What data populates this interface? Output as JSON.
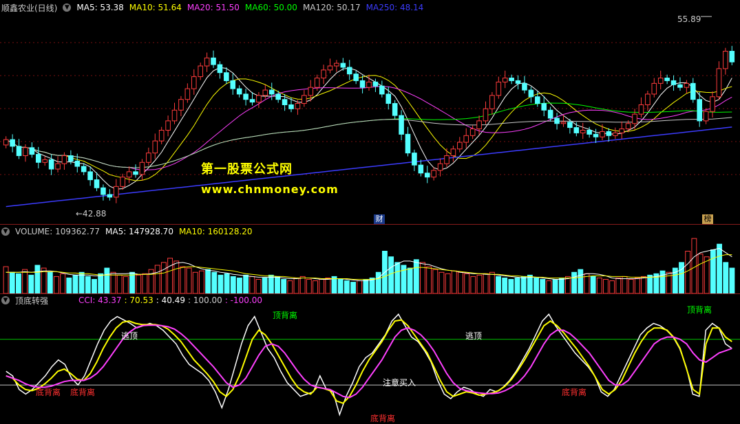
{
  "colors": {
    "up": "#ff3c3c",
    "down": "#54ffff",
    "ma5": "#ffffff",
    "ma10": "#ffff00",
    "ma20": "#ff40ff",
    "ma60": "#00ff00",
    "ma120": "#cccccc",
    "ma250": "#3c3cff",
    "grid": "#7a1010",
    "cci_white": "#ffffff",
    "cci_yellow": "#ffff00",
    "cci_magenta": "#ff40ff",
    "level_green": "#00c000",
    "level_white": "#c0c0c0"
  },
  "price_panel": {
    "title": "顺鑫农业(日线)",
    "collapse_icon": "chevron-down-icon",
    "ma_labels": [
      {
        "text": "MA5: 53.38",
        "color": "#ffffff"
      },
      {
        "text": "MA10: 51.64",
        "color": "#ffff00"
      },
      {
        "text": "MA20: 51.50",
        "color": "#ff40ff"
      },
      {
        "text": "MA60: 50.00",
        "color": "#00ff00"
      },
      {
        "text": "MA120: 50.17",
        "color": "#cccccc"
      },
      {
        "text": "MA250: 48.14",
        "color": "#3c3cff"
      }
    ],
    "high_label": "55.89",
    "low_label": "42.88",
    "event_tags": [
      "财",
      "榜"
    ]
  },
  "watermark": {
    "line1": "第一股票公式网",
    "line2": "www.chnmoney.com"
  },
  "volume_panel": {
    "labels": [
      {
        "text": "VOLUME: 109362.77",
        "color": "#cccccc"
      },
      {
        "text": "MA5: 147928.70",
        "color": "#ffffff"
      },
      {
        "text": "MA10: 160128.20",
        "color": "#ffff00"
      }
    ]
  },
  "indicator_panel": {
    "title": "顶底转强",
    "labels": [
      {
        "text": "CCI: 43.37",
        "color": "#ff40ff"
      },
      {
        "text": ": 70.53",
        "color": "#ffff00"
      },
      {
        "text": ": 40.49",
        "color": "#ffffff"
      },
      {
        "text": ": 100.00",
        "color": "#cccccc"
      },
      {
        "text": ": -100.00",
        "color": "#ff40ff"
      }
    ],
    "annotations": [
      {
        "text": "底背离",
        "color": "#ff3030"
      },
      {
        "text": "底背离",
        "color": "#ff3030"
      },
      {
        "text": "逃顶",
        "color": "#ffffff"
      },
      {
        "text": "逃顶",
        "color": "#ffffff"
      },
      {
        "text": "底背离",
        "color": "#ff3030"
      },
      {
        "text": "底背离",
        "color": "#ff3030"
      },
      {
        "text": "顶背离",
        "color": "#00ff00"
      },
      {
        "text": "注意买入",
        "color": "#ffffff"
      },
      {
        "text": "顶背离",
        "color": "#00ff00"
      }
    ]
  },
  "chart_data": [
    {
      "type": "candlestick",
      "title": "顺鑫农业(日线)",
      "high_marker": 55.89,
      "low_marker": 42.88,
      "ylim": [
        41.5,
        57.0
      ],
      "closes": [
        47.6,
        47.1,
        46.4,
        47.0,
        46.5,
        45.9,
        46.1,
        45.4,
        45.8,
        46.4,
        46.0,
        45.6,
        45.2,
        44.6,
        44.0,
        43.5,
        43.3,
        44.1,
        44.8,
        45.2,
        45.0,
        45.9,
        46.6,
        47.5,
        48.3,
        49.0,
        49.8,
        50.6,
        51.4,
        52.3,
        53.1,
        53.7,
        53.2,
        52.6,
        52.0,
        51.4,
        51.0,
        50.6,
        50.4,
        50.9,
        51.3,
        51.0,
        50.6,
        50.2,
        49.9,
        50.3,
        50.9,
        51.5,
        52.2,
        52.8,
        53.1,
        53.3,
        53.0,
        52.5,
        52.0,
        51.5,
        51.9,
        51.6,
        51.0,
        50.3,
        49.4,
        48.0,
        46.6,
        45.7,
        45.1,
        44.8,
        45.3,
        45.8,
        46.4,
        46.9,
        47.4,
        47.9,
        48.4,
        49.0,
        49.9,
        50.9,
        51.9,
        52.2,
        52.0,
        51.8,
        51.3,
        50.8,
        50.3,
        49.8,
        49.2,
        48.8,
        48.9,
        48.5,
        48.1,
        48.3,
        48.0,
        47.8,
        48.2,
        47.9,
        48.1,
        48.4,
        48.8,
        49.5,
        50.2,
        51.0,
        51.8,
        52.2,
        52.0,
        51.7,
        51.5,
        51.8,
        50.6,
        49.0,
        49.7,
        50.8,
        52.9,
        54.2,
        53.4
      ],
      "opens": [
        47.2,
        47.6,
        47.1,
        46.4,
        47.0,
        46.5,
        45.9,
        46.1,
        45.4,
        45.8,
        46.4,
        46.0,
        45.6,
        45.2,
        44.6,
        44.0,
        43.5,
        43.3,
        44.1,
        44.8,
        45.2,
        45.0,
        45.9,
        46.6,
        47.5,
        48.3,
        49.0,
        49.8,
        50.6,
        51.4,
        52.3,
        53.1,
        53.7,
        53.2,
        52.6,
        52.0,
        51.4,
        51.0,
        50.6,
        50.4,
        50.9,
        51.3,
        51.0,
        50.6,
        50.2,
        49.9,
        50.3,
        50.9,
        51.5,
        52.2,
        52.8,
        53.1,
        53.3,
        53.0,
        52.5,
        52.0,
        51.5,
        51.9,
        51.6,
        51.0,
        50.3,
        49.4,
        48.0,
        46.6,
        45.7,
        45.1,
        44.8,
        45.3,
        45.8,
        46.4,
        46.9,
        47.4,
        47.9,
        48.4,
        49.0,
        49.9,
        50.9,
        51.9,
        52.2,
        52.0,
        51.8,
        51.3,
        50.8,
        50.3,
        49.8,
        49.2,
        48.8,
        48.9,
        48.5,
        48.1,
        48.3,
        48.0,
        47.8,
        48.2,
        47.9,
        48.1,
        48.4,
        48.8,
        49.5,
        50.2,
        51.0,
        51.8,
        52.2,
        52.0,
        51.7,
        51.5,
        51.8,
        50.6,
        49.0,
        49.7,
        50.8,
        52.9,
        54.2
      ]
    },
    {
      "type": "bar",
      "title": "VOLUME",
      "values": [
        38,
        30,
        28,
        34,
        26,
        40,
        36,
        30,
        24,
        28,
        22,
        26,
        30,
        24,
        20,
        28,
        36,
        30,
        26,
        24,
        30,
        26,
        28,
        34,
        40,
        44,
        50,
        46,
        38,
        36,
        30,
        32,
        34,
        30,
        26,
        28,
        24,
        22,
        26,
        24,
        20,
        22,
        26,
        24,
        20,
        18,
        22,
        24,
        20,
        18,
        20,
        22,
        24,
        20,
        18,
        16,
        18,
        20,
        22,
        30,
        60,
        52,
        44,
        40,
        36,
        48,
        44,
        38,
        34,
        30,
        28,
        32,
        30,
        28,
        24,
        26,
        28,
        30,
        24,
        22,
        20,
        22,
        24,
        26,
        22,
        20,
        18,
        20,
        22,
        24,
        30,
        34,
        28,
        24,
        22,
        20,
        18,
        22,
        24,
        20,
        22,
        24,
        26,
        28,
        32,
        30,
        36,
        44,
        60,
        78,
        56,
        52,
        62,
        70,
        44,
        36
      ],
      "ma5": [
        30,
        30,
        30,
        31,
        30,
        31,
        32,
        32,
        31,
        29,
        27,
        26,
        26,
        26,
        25,
        25,
        27,
        28,
        28,
        28,
        29,
        27,
        27,
        28,
        30,
        34,
        39,
        43,
        44,
        42,
        38,
        35,
        33,
        32,
        30,
        29,
        27,
        26,
        25,
        24,
        23,
        23,
        23,
        23,
        22,
        21,
        21,
        22,
        22,
        21,
        20,
        20,
        21,
        21,
        20,
        19,
        18,
        18,
        19,
        22,
        30,
        37,
        42,
        46,
        46,
        44,
        42,
        41,
        38,
        35,
        33,
        32,
        30,
        29,
        28,
        28,
        27,
        27,
        26,
        25,
        24,
        23,
        22,
        23,
        23,
        22,
        21,
        20,
        20,
        21,
        23,
        26,
        28,
        28,
        27,
        25,
        22,
        21,
        21,
        21,
        21,
        22,
        23,
        24,
        26,
        28,
        30,
        34,
        42,
        52,
        58,
        60,
        62,
        64,
        58,
        52
      ],
      "ma10": [
        30,
        30,
        30,
        30,
        30,
        30,
        31,
        31,
        31,
        30,
        29,
        29,
        28,
        28,
        27,
        26,
        26,
        26,
        26,
        26,
        26,
        27,
        27,
        27,
        28,
        29,
        32,
        35,
        37,
        38,
        38,
        37,
        36,
        35,
        34,
        33,
        32,
        30,
        28,
        27,
        26,
        25,
        25,
        24,
        24,
        23,
        22,
        22,
        22,
        22,
        21,
        21,
        21,
        21,
        21,
        20,
        20,
        20,
        20,
        21,
        24,
        28,
        31,
        33,
        35,
        37,
        37,
        36,
        35,
        34,
        33,
        32,
        31,
        30,
        29,
        28,
        28,
        27,
        27,
        26,
        25,
        25,
        24,
        24,
        23,
        23,
        22,
        22,
        22,
        22,
        22,
        23,
        24,
        25,
        25,
        25,
        24,
        24,
        24,
        23,
        23,
        23,
        23,
        23,
        24,
        25,
        26,
        28,
        32,
        37,
        42,
        46,
        50,
        53,
        55,
        55
      ]
    },
    {
      "type": "line",
      "title": "顶底转强",
      "levels": [
        100,
        -100
      ],
      "ylim": [
        -250,
        250
      ],
      "series": [
        {
          "name": "CCI",
          "values": [
            -40,
            -60,
            -120,
            -140,
            -120,
            -90,
            -60,
            -20,
            10,
            -10,
            -70,
            -100,
            -60,
            10,
            80,
            140,
            180,
            200,
            185,
            170,
            150,
            160,
            170,
            160,
            140,
            110,
            80,
            30,
            -10,
            -30,
            -50,
            -80,
            -130,
            -200,
            -120,
            -20,
            80,
            160,
            200,
            130,
            60,
            20,
            -40,
            -90,
            -120,
            -150,
            -140,
            -130,
            -60,
            -120,
            -130,
            -230,
            -150,
            -90,
            -20,
            20,
            40,
            80,
            120,
            180,
            210,
            160,
            110,
            90,
            50,
            0,
            -80,
            -140,
            -160,
            -130,
            -110,
            -120,
            -140,
            -150,
            -120,
            -130,
            -110,
            -80,
            -40,
            10,
            60,
            120,
            180,
            210,
            160,
            120,
            80,
            40,
            10,
            -20,
            -60,
            -130,
            -150,
            -120,
            -60,
            0,
            60,
            120,
            150,
            170,
            160,
            140,
            110,
            60,
            -20,
            -140,
            -150,
            140,
            170,
            150,
            80,
            60
          ]
        },
        {
          "name": "",
          "values": [
            -60,
            -70,
            -100,
            -120,
            -125,
            -115,
            -95,
            -70,
            -40,
            -30,
            -50,
            -75,
            -80,
            -50,
            0,
            60,
            110,
            150,
            175,
            180,
            170,
            165,
            165,
            165,
            160,
            145,
            120,
            90,
            50,
            10,
            -20,
            -50,
            -85,
            -130,
            -150,
            -120,
            -60,
            20,
            100,
            140,
            120,
            80,
            30,
            -20,
            -70,
            -110,
            -130,
            -140,
            -110,
            -115,
            -125,
            -170,
            -180,
            -150,
            -100,
            -40,
            10,
            50,
            90,
            140,
            180,
            185,
            160,
            120,
            80,
            40,
            -20,
            -80,
            -130,
            -150,
            -140,
            -130,
            -135,
            -145,
            -140,
            -135,
            -125,
            -105,
            -75,
            -35,
            10,
            60,
            110,
            160,
            180,
            160,
            130,
            95,
            60,
            20,
            -20,
            -70,
            -120,
            -140,
            -120,
            -80,
            -20,
            40,
            90,
            130,
            150,
            150,
            140,
            110,
            60,
            -30,
            -120,
            -140,
            80,
            150,
            150,
            110,
            90
          ]
        },
        {
          "name": "",
          "values": [
            -60,
            -70,
            -80,
            -95,
            -105,
            -110,
            -110,
            -105,
            -95,
            -85,
            -80,
            -80,
            -80,
            -70,
            -50,
            -20,
            20,
            60,
            100,
            130,
            150,
            160,
            162,
            162,
            160,
            155,
            145,
            125,
            100,
            70,
            40,
            10,
            -20,
            -55,
            -90,
            -110,
            -100,
            -70,
            -20,
            30,
            70,
            80,
            70,
            40,
            0,
            -40,
            -75,
            -100,
            -110,
            -115,
            -120,
            -135,
            -150,
            -155,
            -140,
            -110,
            -70,
            -30,
            10,
            60,
            110,
            140,
            150,
            140,
            120,
            90,
            50,
            0,
            -50,
            -90,
            -115,
            -125,
            -130,
            -135,
            -138,
            -138,
            -135,
            -125,
            -110,
            -90,
            -60,
            -20,
            30,
            80,
            120,
            140,
            140,
            125,
            100,
            70,
            40,
            0,
            -40,
            -80,
            -100,
            -100,
            -80,
            -40,
            0,
            40,
            80,
            100,
            110,
            110,
            100,
            80,
            40,
            10,
            0,
            20,
            40,
            50,
            60
          ]
        }
      ]
    }
  ]
}
